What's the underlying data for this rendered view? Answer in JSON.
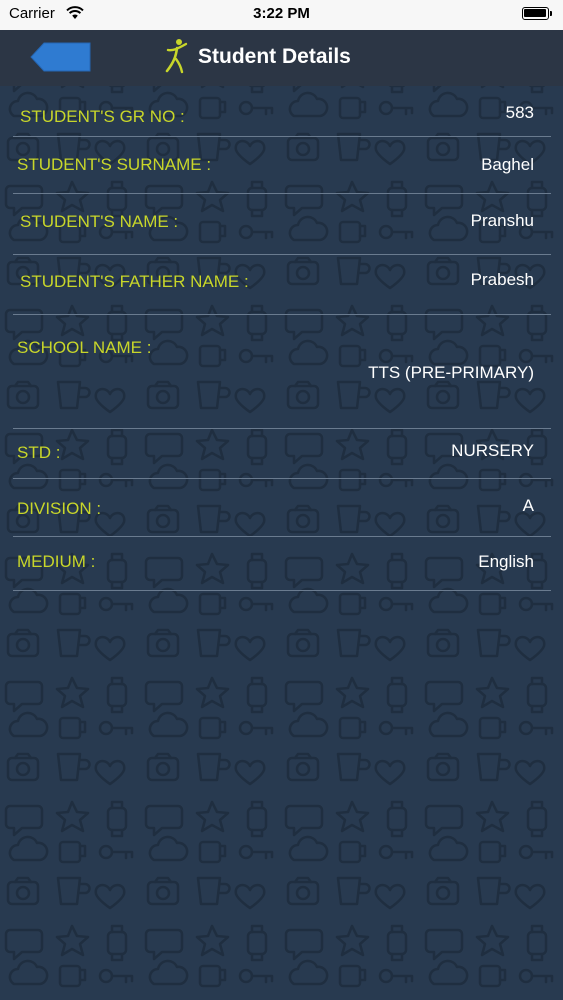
{
  "status_bar": {
    "carrier": "Carrier",
    "time": "3:22 PM"
  },
  "nav": {
    "title": "Student Details",
    "back_icon": "back-arrow-icon",
    "logo_icon": "figure-logo-icon"
  },
  "colors": {
    "label": "#c8d62a",
    "value": "#ffffff",
    "background": "#283a50",
    "nav_background": "#2c3645",
    "back_button": "#2f7bd1"
  },
  "details": [
    {
      "label": "STUDENT'S GR NO :",
      "value": "583"
    },
    {
      "label": "STUDENT'S SURNAME :",
      "value": "Baghel"
    },
    {
      "label": "STUDENT'S NAME :",
      "value": "Pranshu"
    },
    {
      "label": "STUDENT'S FATHER NAME :",
      "value": "Prabesh"
    },
    {
      "label": "SCHOOL NAME :",
      "value": "TTS (PRE-PRIMARY)"
    },
    {
      "label": "STD :",
      "value": "NURSERY"
    },
    {
      "label": "DIVISION :",
      "value": "A"
    },
    {
      "label": "MEDIUM :",
      "value": "English"
    }
  ]
}
